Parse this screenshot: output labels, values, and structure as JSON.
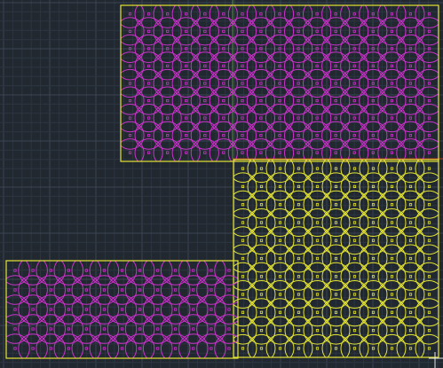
{
  "viewport": {
    "background_color": "#212830",
    "grid_minor_color": "#2c3540",
    "grid_major_color": "#3a4652",
    "ucs_x_axis_color": "#b23a2a",
    "ucs_y_axis_color": "#4f8f3a"
  },
  "layers": [
    {
      "name": "magenta-pattern-top",
      "color": "#cc33cc",
      "circle_rows": 9,
      "circle_cols": 17
    },
    {
      "name": "yellow-pattern-right",
      "color": "#e6e633",
      "circle_rows": 11,
      "circle_cols": 11
    },
    {
      "name": "magenta-pattern-bottom-left",
      "color": "#cc33cc",
      "circle_rows": 5,
      "circle_cols": 13
    }
  ]
}
